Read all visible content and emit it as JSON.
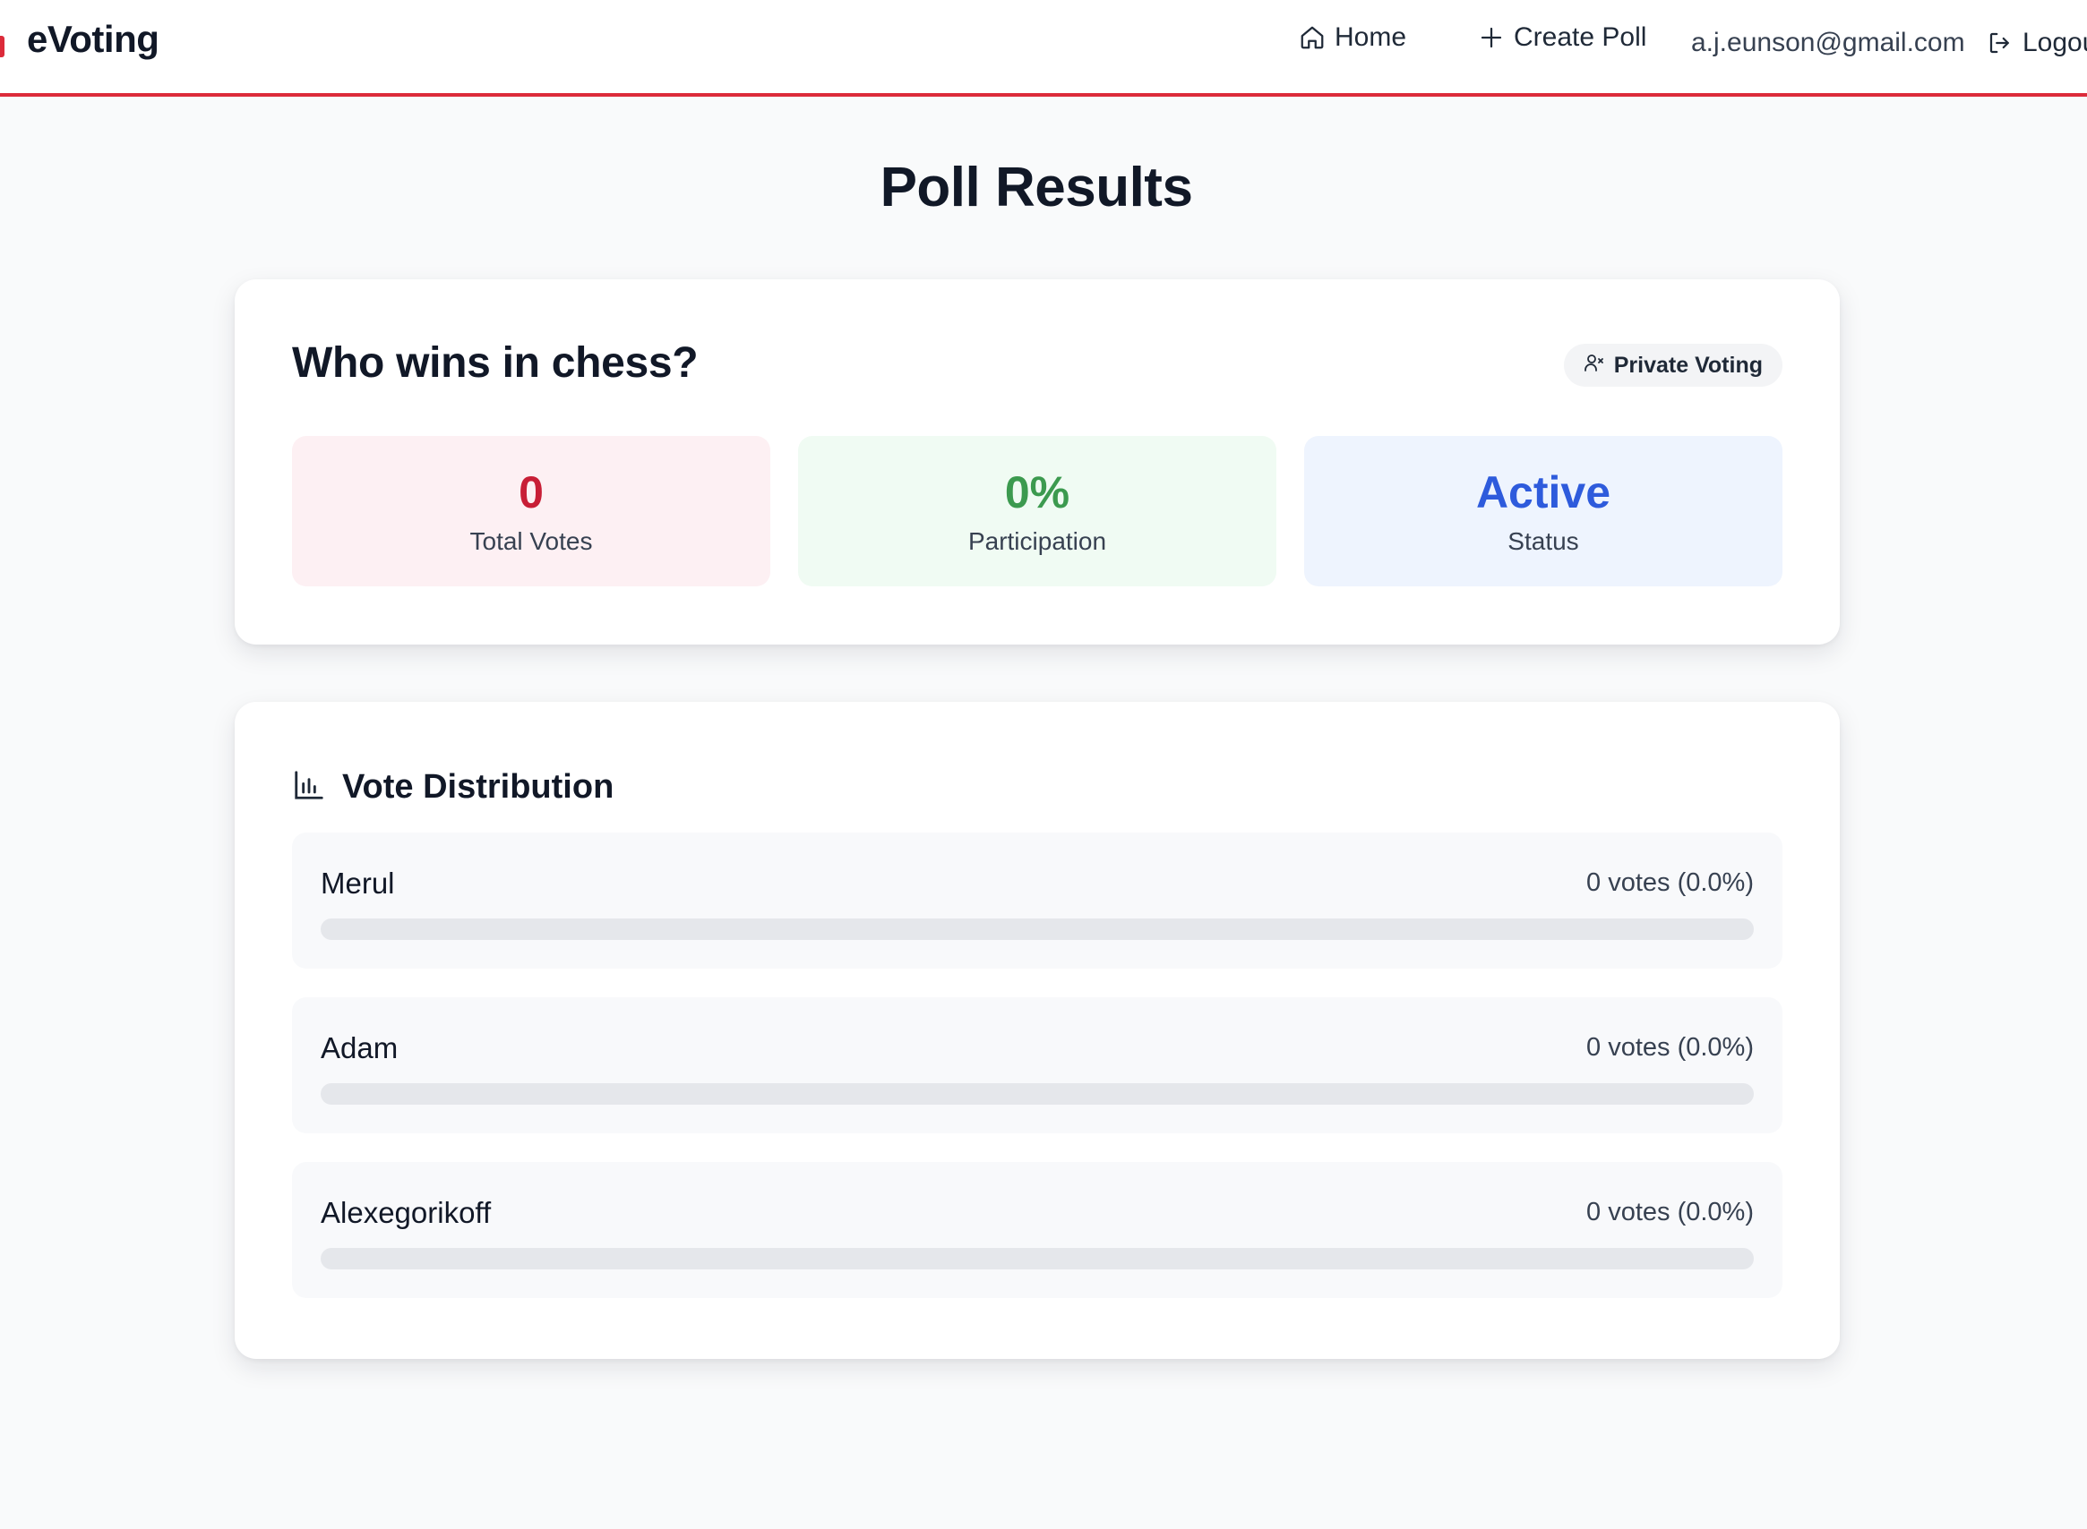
{
  "nav": {
    "brand": "eVoting",
    "home_label": "Home",
    "create_label": "Create Poll",
    "user_email": "a.j.eunson@gmail.com",
    "logout_label": "Logou"
  },
  "page": {
    "title": "Poll Results"
  },
  "poll": {
    "question": "Who wins in chess?",
    "visibility_badge": "Private Voting",
    "stats": {
      "total_votes": {
        "value": "0",
        "label": "Total Votes"
      },
      "participation": {
        "value": "0%",
        "label": "Participation"
      },
      "status": {
        "value": "Active",
        "label": "Status"
      }
    }
  },
  "distribution": {
    "title": "Vote Distribution",
    "options": [
      {
        "name": "Merul",
        "count_text": "0 votes (0.0%)",
        "percent": 0
      },
      {
        "name": "Adam",
        "count_text": "0 votes (0.0%)",
        "percent": 0
      },
      {
        "name": "Alexegorikoff",
        "count_text": "0 votes (0.0%)",
        "percent": 0
      }
    ]
  },
  "colors": {
    "accent": "#dc2b3a",
    "votes": "#c81e36",
    "participation": "#3c9a4f",
    "status": "#2e5bdc"
  },
  "icons": {
    "home": "home-icon",
    "create": "plus-icon",
    "logout": "logout-icon",
    "badge": "user-x-icon",
    "distribution": "bar-chart-icon"
  }
}
